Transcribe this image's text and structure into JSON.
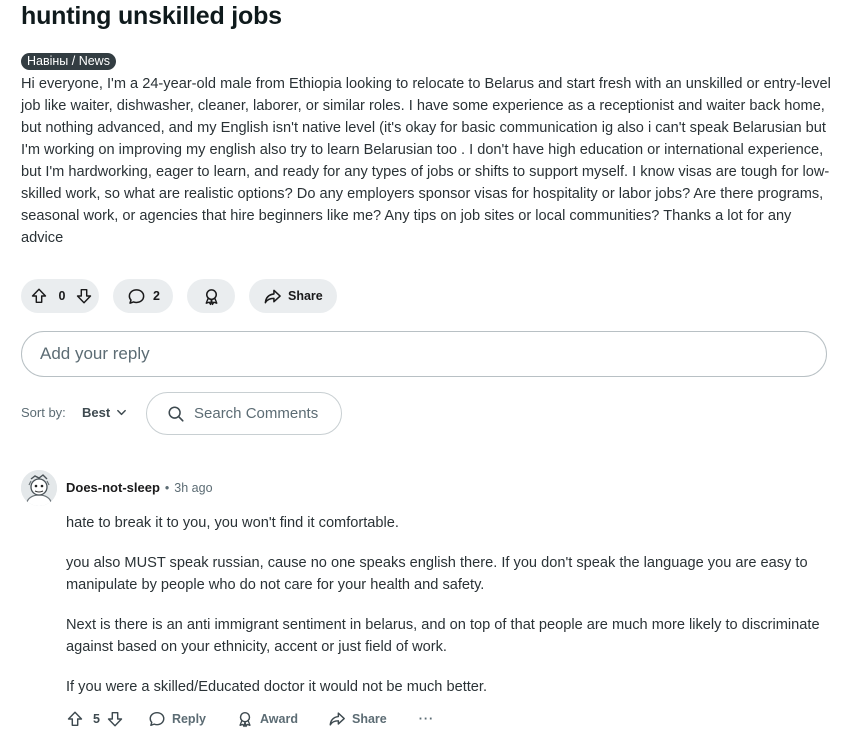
{
  "post": {
    "title": "hunting unskilled jobs",
    "flair": "Навіны / News",
    "body": "Hi everyone, I'm a 24-year-old male from Ethiopia looking to relocate to Belarus and start fresh with an unskilled or entry-level job like waiter, dishwasher, cleaner, laborer, or similar roles. I have some experience as a receptionist and waiter back home, but nothing advanced, and my English isn't native level (it's okay for basic communication ig also i can't speak Belarusian but I'm working on improving my english also try to learn Belarusian too . I don't have high education or international experience, but I'm hardworking, eager to learn, and ready for any types of jobs or shifts to support myself. I know visas are tough for low-skilled work, so what are realistic options? Do any employers sponsor visas for hospitality or labor jobs? Are there programs, seasonal work, or agencies that hire beginners like me? Any tips on job sites or local communities? Thanks a lot for any advice"
  },
  "post_actions": {
    "vote_count": "0",
    "comment_count": "2",
    "share_label": "Share"
  },
  "reply_box": {
    "placeholder": "Add your reply"
  },
  "sort": {
    "label": "Sort by:",
    "value": "Best"
  },
  "search": {
    "placeholder": "Search Comments"
  },
  "comment": {
    "author": "Does-not-sleep",
    "separator": "•",
    "time": "3h ago",
    "paragraphs": [
      "hate to break it to you, you won't find it comfortable.",
      "you also MUST speak russian, cause no one speaks english there. If you don't speak the language you are easy to manipulate by people who do not care for your health and safety.",
      "Next is there is an anti immigrant sentiment in belarus, and on top of that people are much more likely to discriminate against based on your ethnicity, accent or just field of work.",
      "If you were a skilled/Educated doctor it would not be much better."
    ],
    "vote_count": "5",
    "reply_label": "Reply",
    "award_label": "Award",
    "share_label": "Share",
    "more_label": "···"
  },
  "icons": {
    "upvote": "upvote-arrow-icon",
    "downvote": "downvote-arrow-icon",
    "comment": "speech-bubble-icon",
    "award": "award-ribbon-icon",
    "share": "share-arrow-icon",
    "search": "magnifier-icon",
    "chevron": "chevron-down-icon"
  },
  "colors": {
    "pill_bg": "#eaedef",
    "flair_bg": "#333d42",
    "border": "#b8c0c4",
    "muted_text": "#5c6c74"
  }
}
